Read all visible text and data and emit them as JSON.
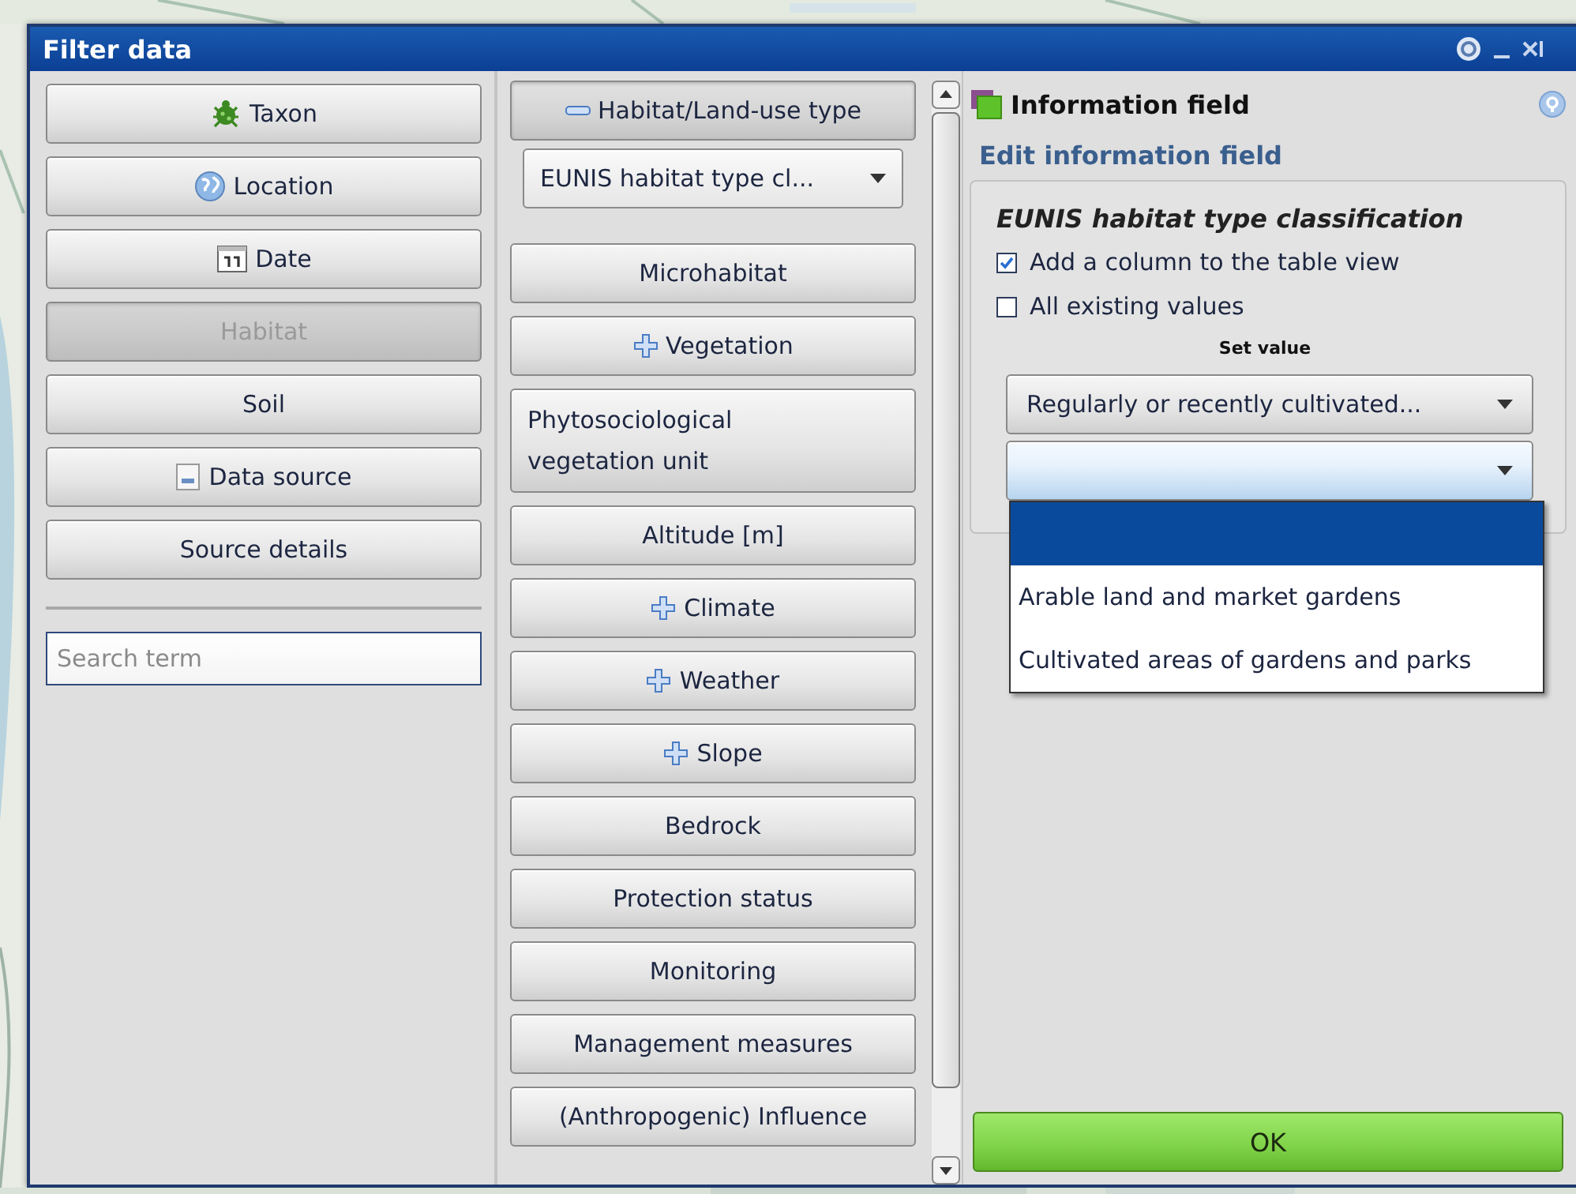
{
  "window": {
    "title": "Filter data"
  },
  "categories": [
    {
      "label": "Taxon",
      "selected": false
    },
    {
      "label": "Location",
      "selected": false
    },
    {
      "label": "Date",
      "selected": false
    },
    {
      "label": "Habitat",
      "selected": true
    },
    {
      "label": "Soil",
      "selected": false
    },
    {
      "label": "Data source",
      "selected": false
    },
    {
      "label": "Source details",
      "selected": false
    }
  ],
  "search": {
    "placeholder": "Search term"
  },
  "fields": [
    {
      "kind": "group",
      "label": "Habitat/Land-use type",
      "expanded": true
    },
    {
      "kind": "select",
      "value": "EUNIS habitat type cl..."
    },
    {
      "kind": "field",
      "label": "Microhabitat"
    },
    {
      "kind": "group",
      "label": "Vegetation",
      "expanded": false
    },
    {
      "kind": "multiline",
      "label": "Phytosociological vegetation unit"
    },
    {
      "kind": "field",
      "label": "Altitude [m]"
    },
    {
      "kind": "group",
      "label": "Climate",
      "expanded": false
    },
    {
      "kind": "group",
      "label": "Weather",
      "expanded": false
    },
    {
      "kind": "group",
      "label": "Slope",
      "expanded": false
    },
    {
      "kind": "field",
      "label": "Bedrock"
    },
    {
      "kind": "field",
      "label": "Protection status"
    },
    {
      "kind": "field",
      "label": "Monitoring"
    },
    {
      "kind": "field",
      "label": "Management measures"
    },
    {
      "kind": "field",
      "label": "(Anthropogenic) Influence"
    }
  ],
  "panel": {
    "title": "Information field",
    "subtitle": "Edit information field",
    "field_title": "EUNIS habitat type classification",
    "options": [
      {
        "label": "Add a column to the table view",
        "checked": true
      },
      {
        "label": "All existing values",
        "checked": false
      }
    ],
    "set_value_label": "Set value",
    "value_select": "Regularly or recently cultivated...",
    "sub_select": {
      "open": true,
      "options": [
        {
          "selected": true
        },
        {
          "label": "Arable land and market gardens",
          "selected": false
        },
        {
          "label": "Cultivated areas of gardens and parks",
          "selected": false
        }
      ]
    }
  },
  "ok_button": "OK"
}
